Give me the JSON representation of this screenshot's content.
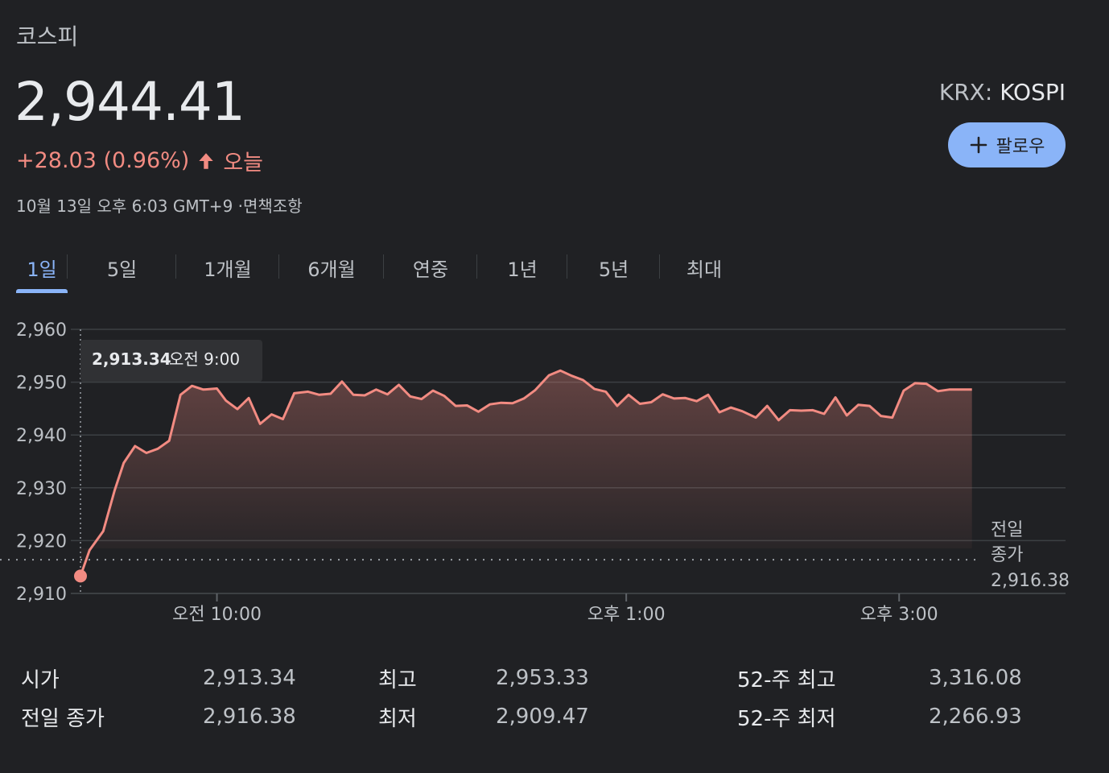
{
  "header": {
    "index_name": "코스피",
    "price": "2,944.41",
    "change": "+28.03 (0.96%)",
    "period": "오늘",
    "timestamp": "10월 13일 오후 6:03 GMT+9 ·면책조항",
    "exchange": "KRX:",
    "ticker": "KOSPI",
    "follow_label": "팔로우"
  },
  "tabs": [
    "1일",
    "5일",
    "1개월",
    "6개월",
    "연중",
    "1년",
    "5년",
    "최대"
  ],
  "active_tab": 0,
  "colors": {
    "line": "#f28b82",
    "accent": "#8ab4f8",
    "background": "#202124",
    "grid": "#3c4043"
  },
  "icons": {
    "follow": "plus-icon",
    "change": "arrow-up-icon"
  },
  "chart_data": {
    "type": "line",
    "ylim": [
      2910,
      2960
    ],
    "y_ticks": [
      "2,910",
      "2,920",
      "2,930",
      "2,940",
      "2,950",
      "2,960"
    ],
    "x_ticks": [
      "오전 10:00",
      "오후 1:00",
      "오후 3:00"
    ],
    "x_tick_times": [
      600,
      780,
      900
    ],
    "x_range": [
      540,
      930
    ],
    "previous_close": 2916.38,
    "previous_close_label_line1": "전일",
    "previous_close_label_line2": "종가",
    "previous_close_value": "2,916.38",
    "tooltip": {
      "value": "2,913.34",
      "time": "오전 9:00",
      "time_minutes": 540
    },
    "series": [
      {
        "x": [
          540,
          544,
          550,
          555,
          559,
          564,
          569,
          574,
          579,
          584,
          589,
          594,
          600,
          604,
          609,
          614,
          619,
          624,
          629,
          634,
          640,
          645,
          650,
          655,
          660,
          665,
          670,
          675,
          680,
          685,
          690,
          695,
          700,
          705,
          710,
          715,
          720,
          725,
          730,
          735,
          740,
          746,
          751,
          756,
          761,
          766,
          771,
          776,
          781,
          786,
          791,
          796,
          801,
          806,
          811,
          816,
          821,
          826,
          831,
          837,
          842,
          847,
          852,
          857,
          862,
          867,
          872,
          877,
          882,
          887,
          892,
          897,
          902,
          907,
          912,
          917,
          922,
          927,
          932
        ],
        "y": [
          2913.3,
          2918.2,
          2921.8,
          2929.5,
          2934.7,
          2937.9,
          2936.6,
          2937.4,
          2938.9,
          2947.6,
          2949.3,
          2948.6,
          2948.8,
          2946.5,
          2944.9,
          2947.0,
          2942.1,
          2943.9,
          2943.0,
          2947.9,
          2948.2,
          2947.6,
          2947.8,
          2950.1,
          2947.6,
          2947.5,
          2948.6,
          2947.7,
          2949.5,
          2947.3,
          2946.8,
          2948.4,
          2947.4,
          2945.5,
          2945.6,
          2944.4,
          2945.8,
          2946.1,
          2946.0,
          2946.9,
          2948.5,
          2951.3,
          2952.2,
          2951.2,
          2950.4,
          2948.7,
          2948.2,
          2945.5,
          2947.6,
          2945.9,
          2946.2,
          2947.7,
          2946.9,
          2947.0,
          2946.4,
          2947.6,
          2944.3,
          2945.2,
          2944.5,
          2943.3,
          2945.5,
          2942.8,
          2944.7,
          2944.6,
          2944.7,
          2944.0,
          2947.1,
          2943.7,
          2945.7,
          2945.5,
          2943.6,
          2943.3,
          2948.4,
          2949.8,
          2949.7,
          2948.3,
          2948.6,
          2948.6,
          2948.6
        ]
      }
    ]
  },
  "stats": {
    "col1": [
      {
        "label": "시가",
        "value": "2,913.34"
      },
      {
        "label": "전일 종가",
        "value": "2,916.38"
      }
    ],
    "col2": [
      {
        "label": "최고",
        "value": "2,953.33"
      },
      {
        "label": "최저",
        "value": "2,909.47"
      }
    ],
    "col3": [
      {
        "label": "52-주 최고",
        "value": "3,316.08"
      },
      {
        "label": "52-주 최저",
        "value": "2,266.93"
      }
    ]
  }
}
